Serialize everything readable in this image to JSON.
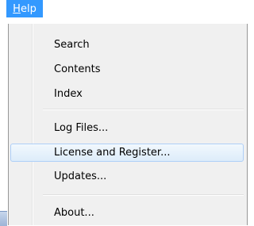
{
  "menubar": {
    "help_accel": "H",
    "help_rest": "elp"
  },
  "menu": {
    "items": [
      {
        "label": "Search"
      },
      {
        "label": "Contents"
      },
      {
        "label": "Index"
      },
      {
        "label": "Log Files..."
      },
      {
        "label": "License and Register..."
      },
      {
        "label": "Updates..."
      },
      {
        "label": "About..."
      }
    ]
  },
  "colors": {
    "menubar_active": "#3399ff",
    "menu_background": "#f0f0f0",
    "highlight_border": "#aecff7"
  }
}
